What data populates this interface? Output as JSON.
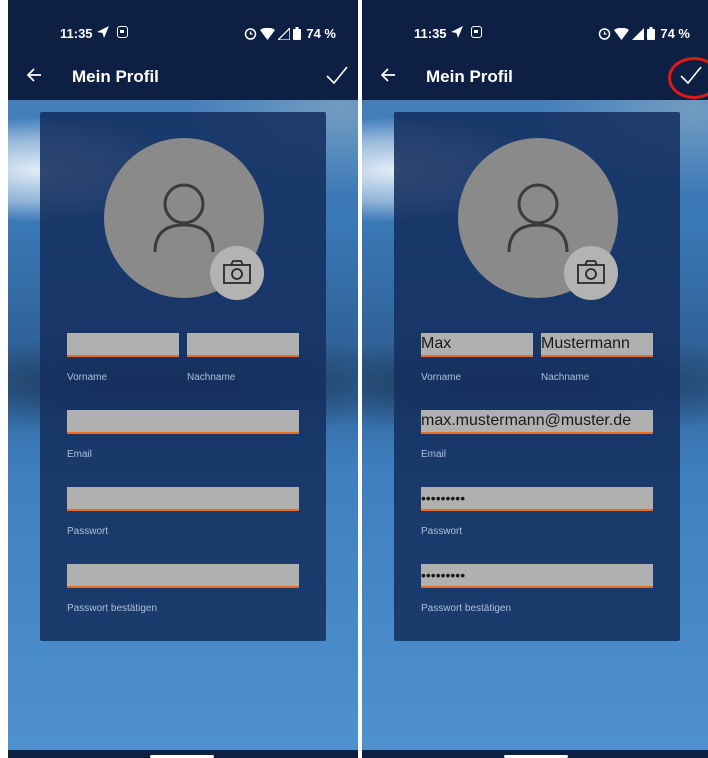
{
  "status": {
    "time": "11:35",
    "battery_percent": "74 %"
  },
  "appbar": {
    "title": "Mein Profil"
  },
  "form": {
    "labels": {
      "first_name": "Vorname",
      "last_name": "Nachname",
      "email": "Email",
      "password": "Passwort",
      "password_confirm": "Passwort bestätigen"
    },
    "empty": {
      "first_name": "",
      "last_name": "",
      "email": "",
      "password": "",
      "password_confirm": ""
    },
    "filled": {
      "first_name": "Max",
      "last_name": "Mustermann",
      "email": "max.mustermann@muster.de",
      "password": "•••••••••",
      "password_confirm": "•••••••••"
    }
  },
  "colors": {
    "bar": "#0e1f44",
    "card": "#143060",
    "field": "#b0b0b0",
    "underline": "#f06a1e",
    "highlight": "#e01818"
  },
  "icons": [
    "back-arrow-icon",
    "check-icon",
    "user-icon",
    "camera-icon",
    "send-icon",
    "alarm-icon",
    "wifi-icon",
    "signal-icon",
    "battery-icon"
  ]
}
